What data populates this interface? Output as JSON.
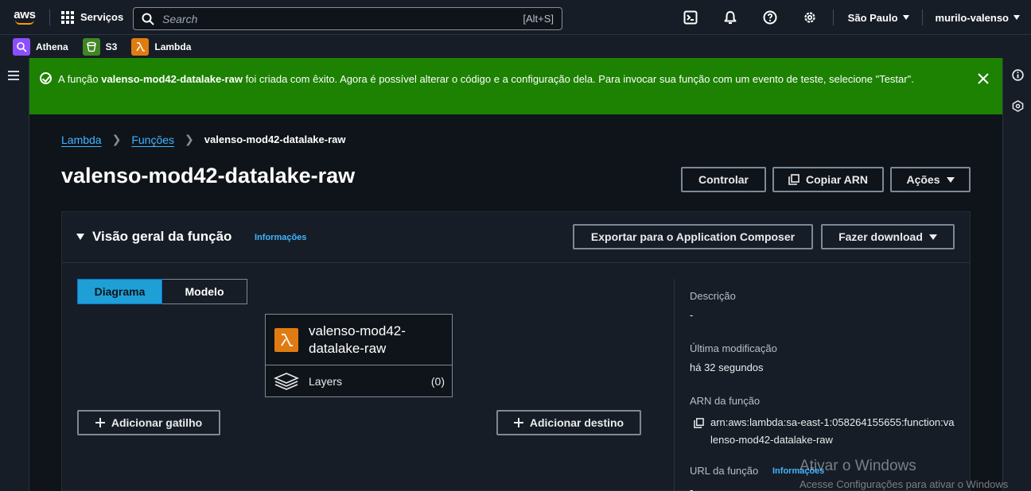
{
  "topnav": {
    "logo_text": "aws",
    "services_label": "Serviços",
    "search_placeholder": "Search",
    "search_shortcut": "[Alt+S]",
    "region": "São Paulo",
    "user": "murilo-valenso"
  },
  "favorites": [
    {
      "label": "Athena",
      "color": "#8c4fff"
    },
    {
      "label": "S3",
      "color": "#3f8624"
    },
    {
      "label": "Lambda",
      "color": "#e07b12"
    }
  ],
  "flash": {
    "prefix": "A função ",
    "function_name": "valenso-mod42-datalake-raw",
    "suffix": " foi criada com êxito. Agora é possível alterar o código e a configuração dela. Para invocar sua função com um evento de teste, selecione \"Testar\".",
    "color": "#1d8102"
  },
  "breadcrumb": {
    "root": "Lambda",
    "section": "Funções",
    "current": "valenso-mod42-datalake-raw"
  },
  "page": {
    "title": "valenso-mod42-datalake-raw",
    "actions": {
      "throttle": "Controlar",
      "copy_arn": "Copiar ARN",
      "actions": "Ações"
    }
  },
  "overview": {
    "title": "Visão geral da função",
    "info": "Informações",
    "export_button": "Exportar para o Application Composer",
    "download_button": "Fazer download",
    "tabs": [
      "Diagrama",
      "Modelo"
    ],
    "function_name": "valenso-mod42-datalake-raw",
    "function_name_line1": "valenso-mod42-",
    "function_name_line2": "datalake-raw",
    "layers_label": "Layers",
    "layers_count": "(0)",
    "add_trigger": "Adicionar gatilho",
    "add_destination": "Adicionar destino",
    "details": {
      "description_label": "Descrição",
      "description_value": "-",
      "last_modified_label": "Última modificação",
      "last_modified_value": "há 32 segundos",
      "arn_label": "ARN da função",
      "arn_value": "arn:aws:lambda:sa-east-1:058264155655:function:valenso-mod42-datalake-raw",
      "url_label": "URL da função",
      "url_info": "Informações",
      "url_value": "-"
    }
  },
  "watermark": {
    "line1": "Ativar o Windows",
    "line2": "Acesse Configurações para ativar o Windows"
  },
  "icons": [
    "aws-logo",
    "services-grid-icon",
    "search-icon",
    "cloudshell-icon",
    "notifications-icon",
    "help-icon",
    "settings-icon",
    "menu-icon",
    "success-icon",
    "close-icon",
    "info-icon",
    "feedback-icon",
    "copy-icon",
    "lambda-icon",
    "layers-icon",
    "plus-icon"
  ]
}
